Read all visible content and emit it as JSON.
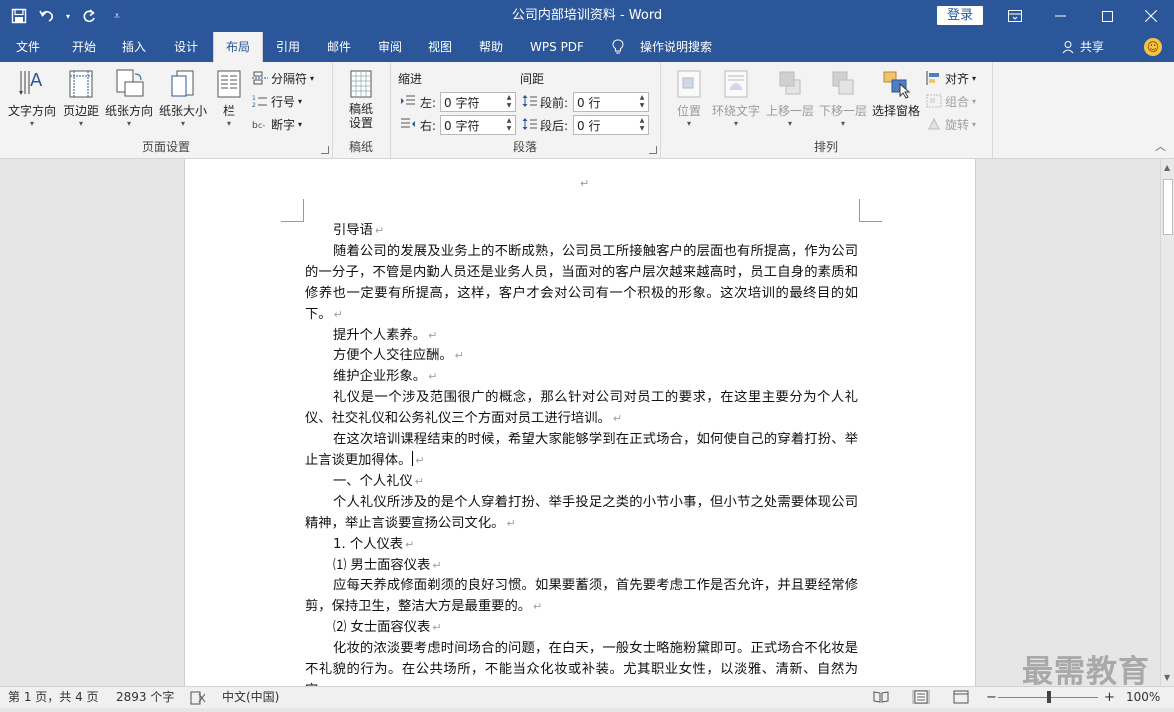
{
  "window": {
    "title": "公司内部培训资料  -  Word",
    "login_label": "登录"
  },
  "qat": {
    "save": "save-icon",
    "undo": "undo-icon",
    "redo": "redo-icon",
    "customize": "customize-icon"
  },
  "tabs": [
    "文件",
    "开始",
    "插入",
    "设计",
    "布局",
    "引用",
    "邮件",
    "审阅",
    "视图",
    "帮助",
    "WPS PDF",
    "操作说明搜索"
  ],
  "active_tab": "布局",
  "share_label": "共享",
  "ribbon": {
    "page_setup": {
      "label": "页面设置",
      "text_direction": "文字方向",
      "margins": "页边距",
      "orientation": "纸张方向",
      "size": "纸张大小",
      "columns": "栏",
      "breaks": "分隔符",
      "line_numbers": "行号",
      "hyphenation": "断字"
    },
    "manuscript": {
      "label": "稿纸",
      "button": "稿纸\n设置"
    },
    "paragraph": {
      "label": "段落",
      "indent_heading": "缩进",
      "spacing_heading": "间距",
      "left_label": "左:",
      "right_label": "右:",
      "before_label": "段前:",
      "after_label": "段后:",
      "left_value": "0 字符",
      "right_value": "0 字符",
      "before_value": "0 行",
      "after_value": "0 行"
    },
    "arrange": {
      "label": "排列",
      "position": "位置",
      "wrap_text": "环绕文字",
      "bring_forward": "上移一层",
      "send_backward": "下移一层",
      "selection_pane": "选择窗格",
      "align": "对齐",
      "group": "组合",
      "rotate": "旋转"
    }
  },
  "document": {
    "paragraphs": [
      "引导语",
      "随着公司的发展及业务上的不断成熟，公司员工所接触客户的层面也有所提高，作为公司的一分子，不管是内勤人员还是业务人员，当面对的客户层次越来越高时，员工自身的素质和修养也一定要有所提高，这样，客户才会对公司有一个积极的形象。这次培训的最终目的如下。",
      "提升个人素养。",
      "方便个人交往应酬。",
      "维护企业形象。",
      "礼仪是一个涉及范围很广的概念，那么针对公司对员工的要求，在这里主要分为个人礼仪、社交礼仪和公务礼仪三个方面对员工进行培训。",
      "在这次培训课程结束的时候，希望大家能够学到在正式场合，如何使自己的穿着打扮、举止言谈更加得体。",
      "一、个人礼仪",
      "个人礼仪所涉及的是个人穿着打扮、举手投足之类的小节小事，但小节之处需要体现公司精神，举止言谈要宣扬公司文化。",
      "1.  个人仪表",
      "⑴ 男士面容仪表",
      "应每天养成修面剃须的良好习惯。如果要蓄须，首先要考虑工作是否允许，并且要经常修剪，保持卫生，整洁大方是最重要的。",
      "⑵ 女士面容仪表",
      "化妆的浓淡要考虑时间场合的问题，在白天，一般女士略施粉黛即可。正式场合不化妆是不礼貌的行为。在公共场所，不能当众化妆或补装。尤其职业女性，以淡雅、清新、自然为宜。"
    ],
    "pilcrow": "↵"
  },
  "status": {
    "page": "第 1 页，共 4 页",
    "words": "2893 个字",
    "language": "中文(中国)",
    "zoom": "100%",
    "zoom_minus": "−",
    "zoom_plus": "+"
  },
  "watermark": "最需教育"
}
